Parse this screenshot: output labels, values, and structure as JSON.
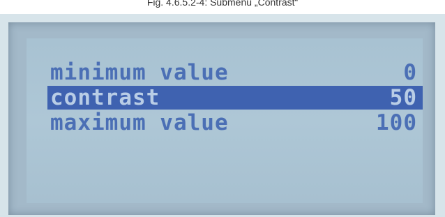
{
  "caption": "Fig. 4.6.5.2-4: Submenu „Contrast“",
  "menu": {
    "rows": [
      {
        "label": "minimum value",
        "value": "0",
        "selected": false
      },
      {
        "label": "contrast",
        "value": "50",
        "selected": true
      },
      {
        "label": "maximum value",
        "value": "100",
        "selected": false
      }
    ]
  },
  "colors": {
    "lcd_background": "#aec7d6",
    "text": "#4b6fb5",
    "highlight": "#3f62b0"
  }
}
